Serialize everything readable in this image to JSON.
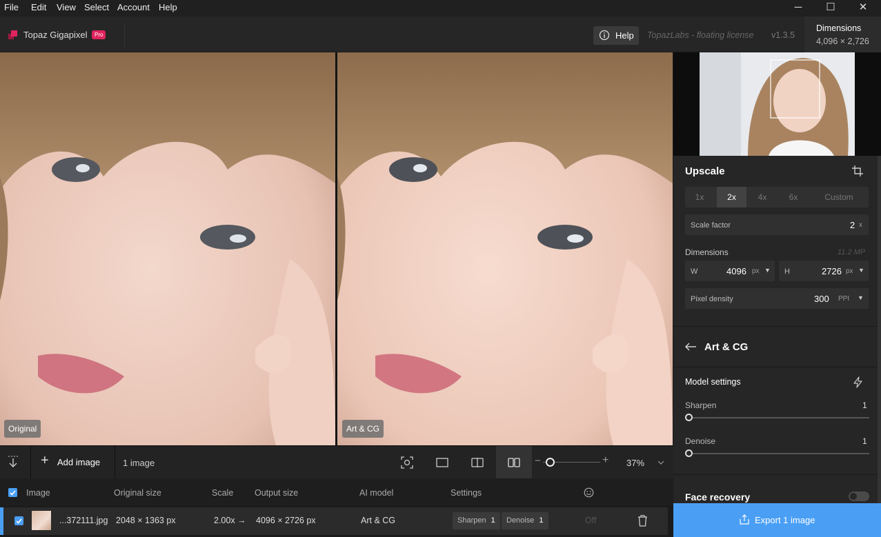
{
  "menu": [
    "File",
    "Edit",
    "View",
    "Select",
    "Account",
    "Help"
  ],
  "window_controls": {
    "minimize": "─",
    "maximize": "☐",
    "close": "✕"
  },
  "app": {
    "name": "Topaz Gigapixel",
    "badge": "Pro",
    "help_label": "Help",
    "license": "TopazLabs - floating license",
    "version": "v1.3.5"
  },
  "header_dims": {
    "label": "Dimensions",
    "value": "4,096 × 2,726"
  },
  "views": {
    "left_label": "Original",
    "right_label": "Art & CG"
  },
  "toolbar": {
    "add_image": "Add image",
    "count": "1 image",
    "zoom": "37%"
  },
  "table": {
    "headers": {
      "image": "Image",
      "original_size": "Original size",
      "scale": "Scale",
      "output_size": "Output size",
      "ai_model": "AI model",
      "settings": "Settings"
    },
    "rows": [
      {
        "filename": "...372111.jpg",
        "original_size": "2048 × 1363 px",
        "scale": "2.00x →",
        "output_size": "4096 × 2726 px",
        "ai_model": "Art & CG",
        "sharpen_label": "Sharpen",
        "sharpen_value": "1",
        "denoise_label": "Denoise",
        "denoise_value": "1",
        "face": "Off"
      }
    ]
  },
  "panel": {
    "upscale_title": "Upscale",
    "scale_options": [
      "1x",
      "2x",
      "4x",
      "6x",
      "Custom"
    ],
    "selected_scale": "2x",
    "scale_factor_label": "Scale factor",
    "scale_factor_value": "2",
    "scale_factor_unit": "x",
    "dimensions_label": "Dimensions",
    "megapixels": "11.2 MP",
    "width_label": "W",
    "width_value": "4096",
    "width_unit": "px",
    "height_label": "H",
    "height_value": "2726",
    "height_unit": "px",
    "density_label": "Pixel density",
    "density_value": "300",
    "density_unit": "PPI",
    "model_title": "Art & CG",
    "model_settings_label": "Model settings",
    "sharpen_label": "Sharpen",
    "sharpen_value": "1",
    "sharpen_level": 0.0,
    "denoise_label": "Denoise",
    "denoise_value": "1",
    "denoise_level": 0.0,
    "face_recovery_label": "Face recovery",
    "face_recovery_on": false,
    "export_label": "Export 1 image"
  },
  "colors": {
    "accent": "#4a9ff5",
    "pro_badge": "#e0245e",
    "logo": "#e0245e"
  }
}
